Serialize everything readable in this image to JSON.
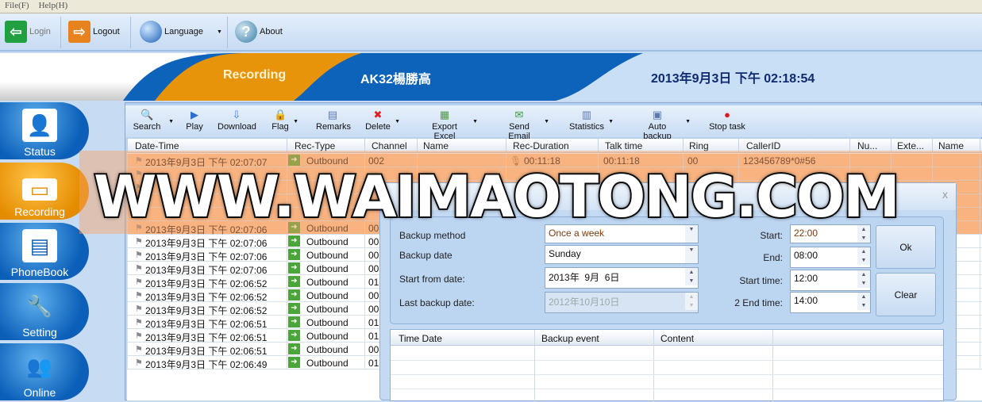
{
  "menu": [
    "File(F)",
    "Help(H)"
  ],
  "toolbar": {
    "login": "Login",
    "logout": "Logout",
    "language": "Language",
    "about": "About"
  },
  "banner": {
    "section": "Recording",
    "user": "AK32楊勝高",
    "datetime": "2013年9月3日 下午 02:18:54"
  },
  "sidebar": [
    {
      "label": "Status",
      "icon": "person-desk-icon"
    },
    {
      "label": "Recording",
      "icon": "cassette-icon",
      "active": true
    },
    {
      "label": "PhoneBook",
      "icon": "contact-card-icon"
    },
    {
      "label": "Setting",
      "icon": "wrench-icon"
    },
    {
      "label": "Online",
      "icon": "people-icon"
    }
  ],
  "rectoolbar": [
    "Search",
    "Play",
    "Download",
    "Flag",
    "Remarks",
    "Delete",
    "Export Excel",
    "Send Email",
    "Statistics",
    "Auto backup",
    "Stop task"
  ],
  "columns": [
    "Date-Time",
    "Rec-Type",
    "Channel",
    "Name",
    "Rec-Duration",
    "Talk time",
    "Ring",
    "CallerID",
    "Nu...",
    "Exte...",
    "Name"
  ],
  "rows": [
    {
      "dt": "2013年9月3日 下午 02:07:07",
      "type": "Outbound",
      "ch": "002",
      "dur": "00:11:18",
      "talk": "00:11:18",
      "ring": "00",
      "cid": "123456789*0#56"
    },
    {
      "dt": "",
      "type": "",
      "ch": "",
      "dur": "",
      "talk": "",
      "ring": "",
      "cid": ""
    },
    {
      "dt": "",
      "type": "",
      "ch": "",
      "dur": "",
      "talk": "",
      "ring": "",
      "cid": ""
    },
    {
      "dt": "",
      "type": "",
      "ch": "",
      "dur": "",
      "talk": "",
      "ring": "",
      "cid": ""
    },
    {
      "dt": "",
      "type": "",
      "ch": "",
      "dur": "",
      "talk": "",
      "ring": "",
      "cid": ""
    },
    {
      "dt": "2013年9月3日 下午 02:07:06",
      "type": "Outbound",
      "ch": "00"
    },
    {
      "dt": "2013年9月3日 下午 02:07:06",
      "type": "Outbound",
      "ch": "00"
    },
    {
      "dt": "2013年9月3日 下午 02:07:06",
      "type": "Outbound",
      "ch": "00"
    },
    {
      "dt": "2013年9月3日 下午 02:07:06",
      "type": "Outbound",
      "ch": "00"
    },
    {
      "dt": "2013年9月3日 下午 02:06:52",
      "type": "Outbound",
      "ch": "01"
    },
    {
      "dt": "2013年9月3日 下午 02:06:52",
      "type": "Outbound",
      "ch": "00"
    },
    {
      "dt": "2013年9月3日 下午 02:06:52",
      "type": "Outbound",
      "ch": "00"
    },
    {
      "dt": "2013年9月3日 下午 02:06:51",
      "type": "Outbound",
      "ch": "01"
    },
    {
      "dt": "2013年9月3日 下午 02:06:51",
      "type": "Outbound",
      "ch": "01"
    },
    {
      "dt": "2013年9月3日 下午 02:06:51",
      "type": "Outbound",
      "ch": "00"
    },
    {
      "dt": "2013年9月3日 下午 02:06:49",
      "type": "Outbound",
      "ch": "01"
    }
  ],
  "dialog": {
    "close": "x",
    "backup_method_label": "Backup method",
    "backup_method": "Once a week",
    "backup_date_label": "Backup date",
    "backup_date": "Sunday",
    "start_from_label": "Start from date:",
    "start_from": "2013年  9月  6日",
    "last_backup_label": "Last backup date:",
    "last_backup": "2012年10月10日",
    "start_label": "Start:",
    "start": "22:00",
    "end_label": "End:",
    "end": "08:00",
    "start_time_label": "Start time:",
    "start_time": "12:00",
    "end_time2_label": "2 End time:",
    "end_time2": "14:00",
    "ok": "Ok",
    "clear": "Clear",
    "log_columns": [
      "Time Date",
      "Backup event",
      "Content"
    ]
  },
  "watermark": "WWW.WAIMAOTONG.COM",
  "colors": {
    "accent_orange": "#e8940a",
    "accent_blue": "#0b5fb8",
    "highlight_row": "#f8c49a"
  }
}
